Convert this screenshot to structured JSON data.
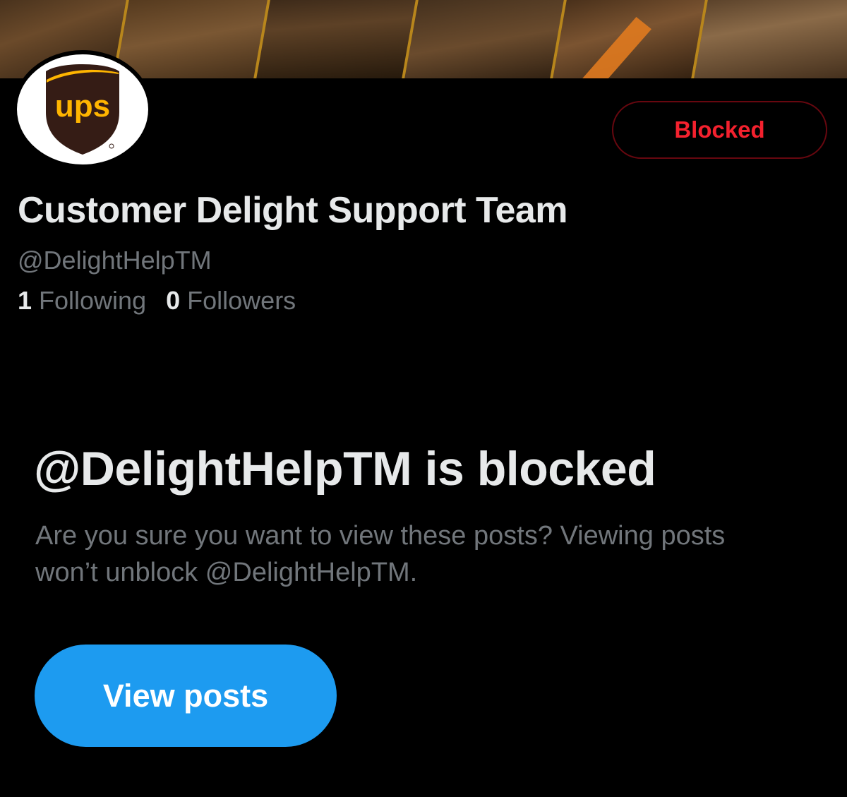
{
  "profile": {
    "display_name": "Customer Delight Support Team",
    "handle": "@DelightHelpTM",
    "following_count": "1",
    "following_label": "Following",
    "followers_count": "0",
    "followers_label": "Followers",
    "avatar_logo_text": "ups",
    "block_status_label": "Blocked"
  },
  "blocked_notice": {
    "title": "@DelightHelpTM is blocked",
    "description": "Are you sure you want to view these posts? Viewing posts won’t unblock @DelightHelpTM.",
    "view_posts_label": "View posts"
  },
  "colors": {
    "background": "#000000",
    "primary_text": "#e7e9ea",
    "secondary_text": "#71767b",
    "blocked_red": "#f4212e",
    "blocked_border": "#67070f",
    "accent_blue": "#1d9bf0",
    "ups_brown": "#351c15",
    "ups_gold": "#ffb500"
  },
  "icons": {
    "avatar": "ups-shield-logo"
  }
}
